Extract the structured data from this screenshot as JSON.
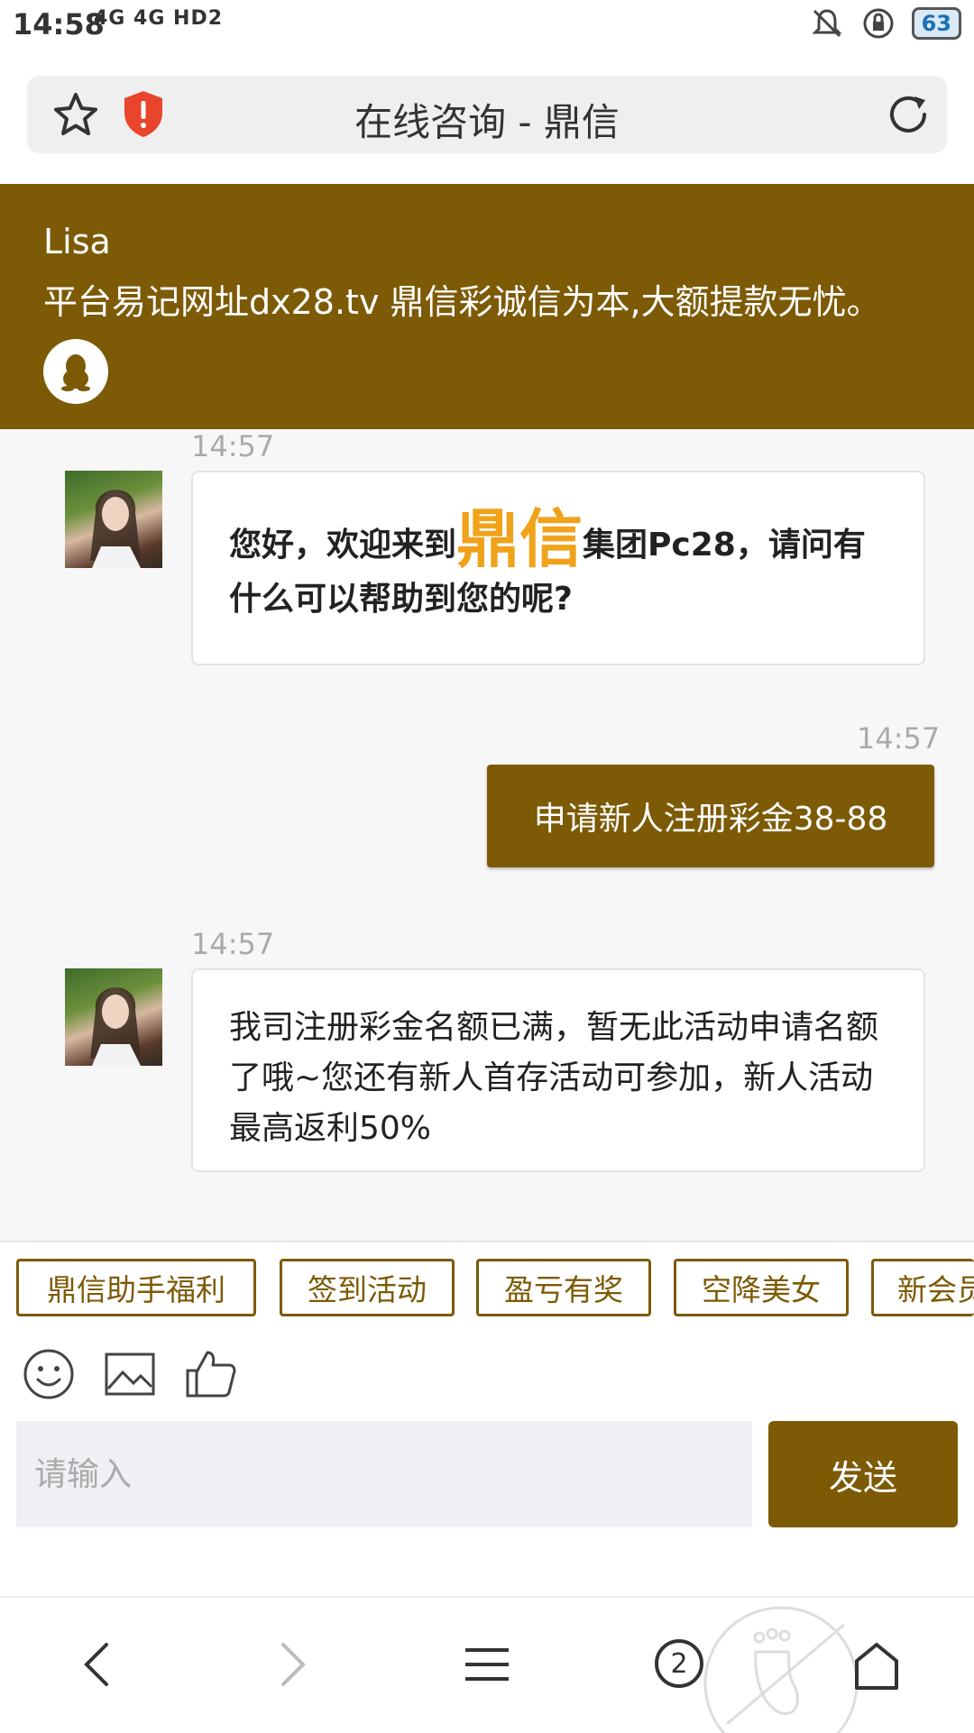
{
  "status_bar": {
    "time": "14:58",
    "signal": "4G 4G HD2",
    "battery": "63"
  },
  "browser": {
    "page_title": "在线咨询 - 鼎信"
  },
  "chat_header": {
    "agent_name": "Lisa",
    "slogan": "平台易记网址dx28.tv 鼎信彩诚信为本,大额提款无忧。"
  },
  "messages": [
    {
      "sender": "agent",
      "time": "14:57",
      "text_before": "您好，欢迎来到",
      "brand": "鼎信",
      "text_after": "集团Pc28，请问有什么可以帮助到您的呢?"
    },
    {
      "sender": "user",
      "time": "14:57",
      "text": "申请新人注册彩金38-88"
    },
    {
      "sender": "agent",
      "time": "14:57",
      "text": "我司注册彩金名额已满，暂无此活动申请名额了哦~您还有新人首存活动可参加，新人活动最高返利50%"
    }
  ],
  "quick_replies": [
    "鼎信助手福利",
    "签到活动",
    "盈亏有奖",
    "空降美女",
    "新会员"
  ],
  "composer": {
    "placeholder": "请输入",
    "send_label": "发送"
  },
  "nav": {
    "tab_count": "2"
  },
  "colors": {
    "brand_brown": "#7d5a06",
    "brand_orange": "#f0a21a"
  }
}
